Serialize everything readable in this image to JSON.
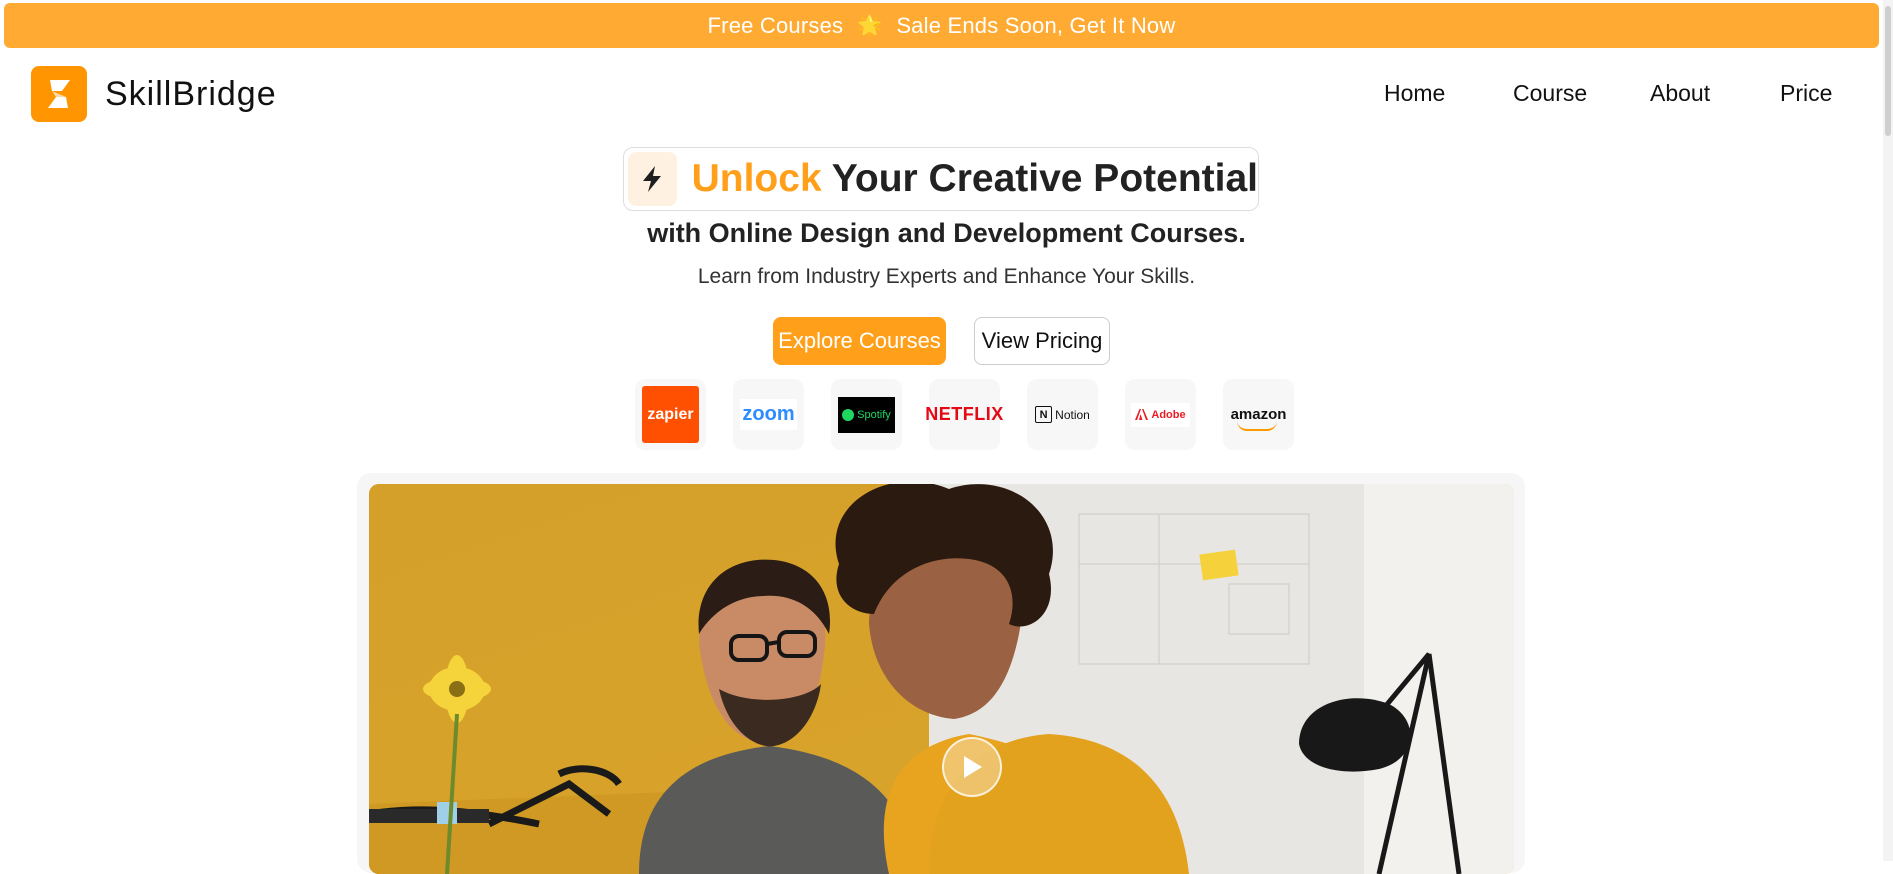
{
  "promo": {
    "left": "Free Courses",
    "star": "🌟",
    "right": "Sale Ends Soon, Get It Now"
  },
  "brand": {
    "name": "SkillBridge"
  },
  "nav": {
    "items": [
      "Home",
      "Course",
      "About",
      "Price"
    ]
  },
  "hero": {
    "headline_accent": "Unlock",
    "headline_rest": " Your Creative Potential",
    "subheadline": "with Online Design and Development Courses.",
    "lead": "Learn from Industry Experts and Enhance Your Skills.",
    "primary_cta": "Explore Courses",
    "secondary_cta": "View Pricing"
  },
  "partners": [
    {
      "name": "zapier"
    },
    {
      "name": "zoom"
    },
    {
      "name": "Spotify"
    },
    {
      "name": "NETFLIX"
    },
    {
      "name": "Notion"
    },
    {
      "name": "Adobe"
    },
    {
      "name": "amazon"
    }
  ],
  "colors": {
    "accent": "#ff9f1a",
    "promo_bar": "#ffab33",
    "logo": "#ff9500"
  },
  "icons": {
    "logo": "skillbridge-logo-icon",
    "headline": "lightning-icon",
    "video": "play-icon"
  }
}
